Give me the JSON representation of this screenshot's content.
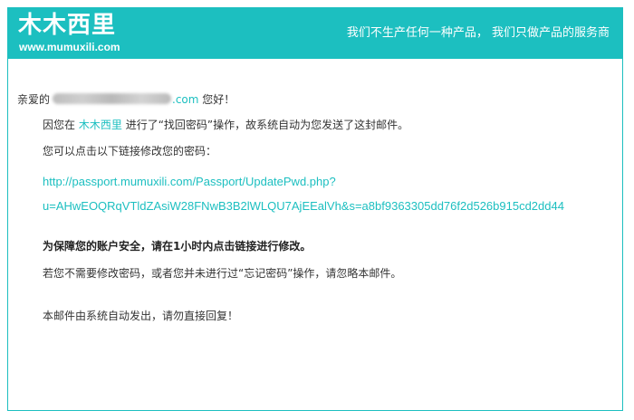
{
  "header": {
    "brand": "木木西里",
    "site": "www.mumuxili.com",
    "slogan": "我们不生产任何一种产品， 我们只做产品的服务商"
  },
  "email": {
    "greeting_prefix": "亲爱的",
    "email_domain": ".com",
    "greeting_suffix": "您好！",
    "line1_prefix": "因您在",
    "line1_brand": "木木西里",
    "line1_suffix": "进行了“找回密码”操作，故系统自动为您发送了这封邮件。",
    "line2": "您可以点击以下链接修改您的密码：",
    "link_line1": "http://passport.mumuxili.com/Passport/UpdatePwd.php?",
    "link_line2": "u=AHwEOQRqVTldZAsiW28FNwB3B2lWLQU7AjEEalVh&s=a8bf9363305dd76f2d526b915cd2dd44",
    "warning": "为保障您的账户安全，请在1小时内点击链接进行修改。",
    "ignore_note": "若您不需要修改密码，或者您并未进行过“忘记密码”操作，请忽略本邮件。",
    "auto_note": "本邮件由系统自动发出，请勿直接回复！"
  },
  "colors": {
    "accent": "#1cbfc0",
    "text": "#333333"
  }
}
